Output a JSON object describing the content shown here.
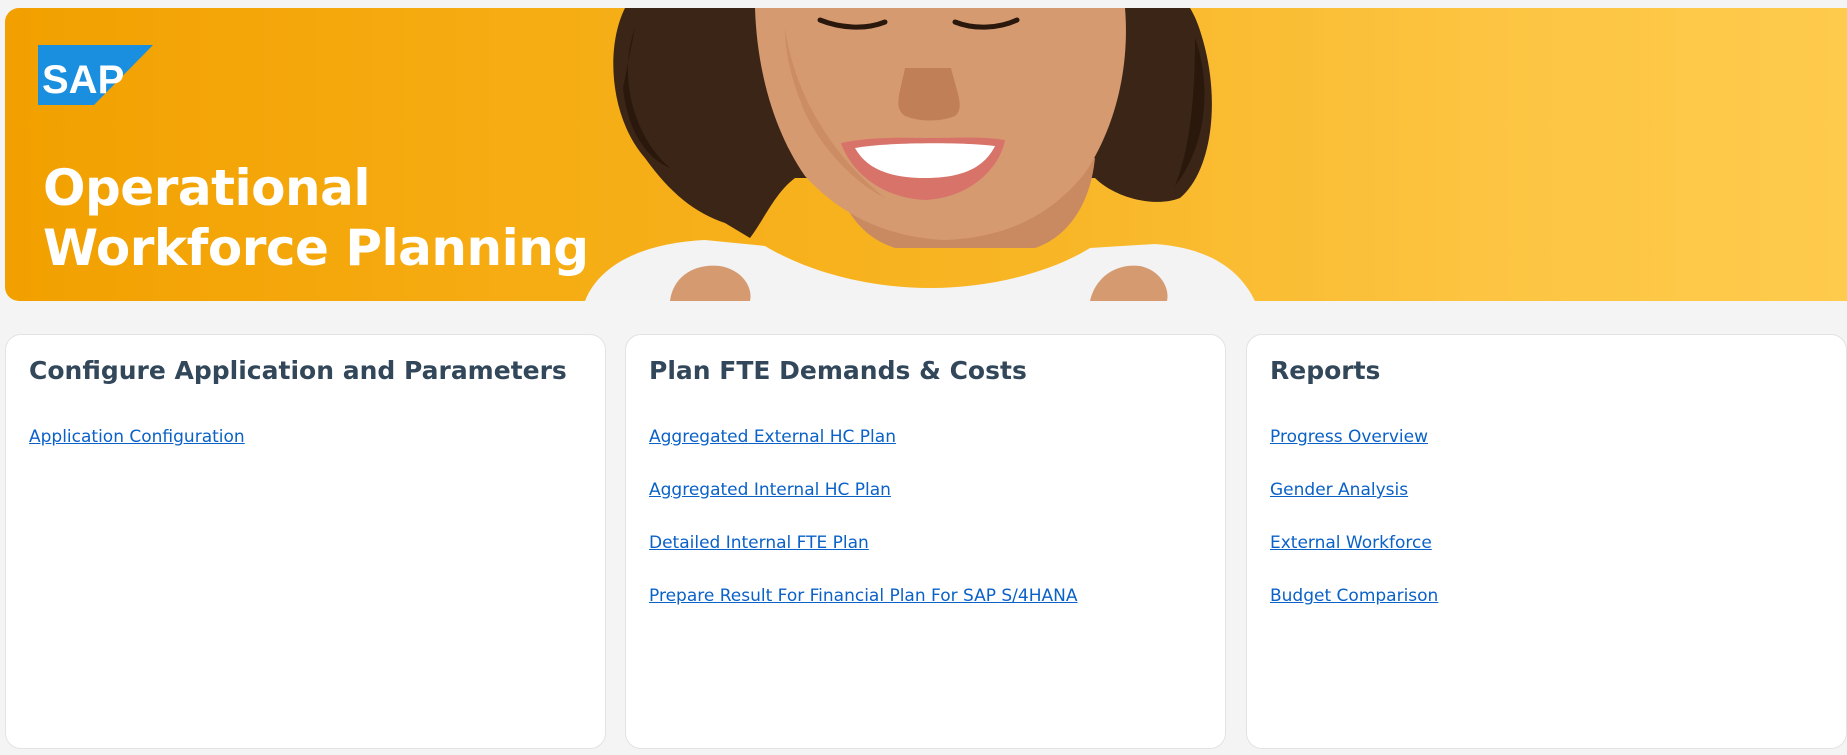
{
  "banner": {
    "logo_text": "SAP",
    "title_line1": "Operational",
    "title_line2": "Workforce Planning",
    "background_color": "#f6a90f",
    "image_description_icon": "smiling-woman-photo"
  },
  "cards": [
    {
      "title": "Configure Application and Parameters",
      "links": [
        "Application Configuration"
      ]
    },
    {
      "title": "Plan FTE Demands & Costs",
      "links": [
        "Aggregated External HC Plan",
        "Aggregated Internal HC Plan",
        "Detailed Internal FTE Plan",
        "Prepare Result For Financial Plan For SAP S/4HANA"
      ]
    },
    {
      "title": "Reports",
      "links": [
        "Progress Overview",
        "Gender Analysis",
        "External Workforce",
        "Budget Comparison"
      ]
    }
  ],
  "colors": {
    "link": "#0a61c7",
    "card_title": "#32475a",
    "page_background": "#f4f4f4",
    "sap_blue": "#1a8fe0"
  }
}
